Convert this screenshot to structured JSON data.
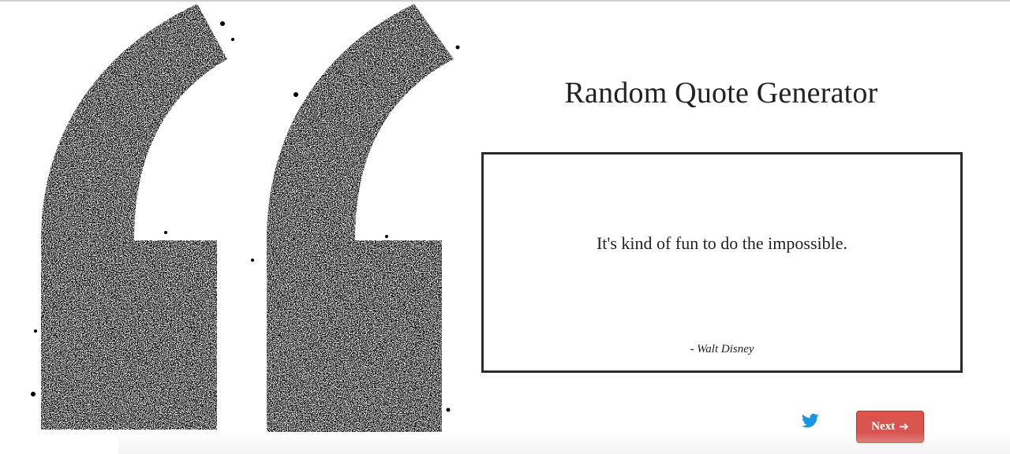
{
  "page": {
    "title": "Random Quote Generator"
  },
  "quote": {
    "text": "It's kind of fun to do the impossible.",
    "author": "- Walt Disney"
  },
  "actions": {
    "tweet_icon": "twitter-bird-icon",
    "next_label": "Next",
    "next_icon": "arrow-right-icon"
  },
  "decoration": {
    "art_icon": "quotation-marks-icon"
  },
  "colors": {
    "accent": "#d9534f",
    "twitter": "#1b95e0",
    "ink": "#000000",
    "text": "#222222"
  }
}
